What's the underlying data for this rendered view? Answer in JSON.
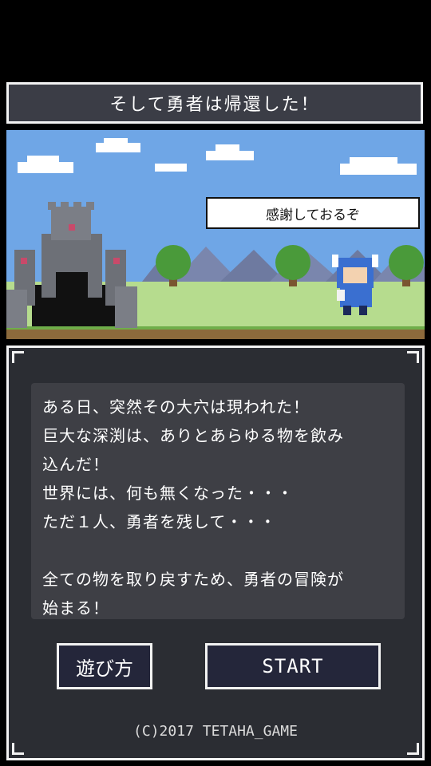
{
  "title": "そして勇者は帰還した！",
  "scene": {
    "speech": "感謝しておるぞ"
  },
  "story": "ある日、突然その大穴は現われた！\n巨大な深渕は、ありとあらゆる物を飲み\n込んだ！\n世界には、何も無くなった・・・\nただ１人、勇者を残して・・・\n\n全ての物を取り戻すため、勇者の冒険が\n始まる！",
  "buttons": {
    "howto_label": "遊び方",
    "start_label": "START"
  },
  "footer": {
    "copyright": "(C)2017 TETAHA_GAME"
  },
  "icons": [
    "castle-icon",
    "tree-icon",
    "hero-knight-icon"
  ],
  "colors": {
    "panel": "#2b2d33",
    "button": "#24263a",
    "sky": "#6fa6e6",
    "grass": "#b6dc8e"
  }
}
